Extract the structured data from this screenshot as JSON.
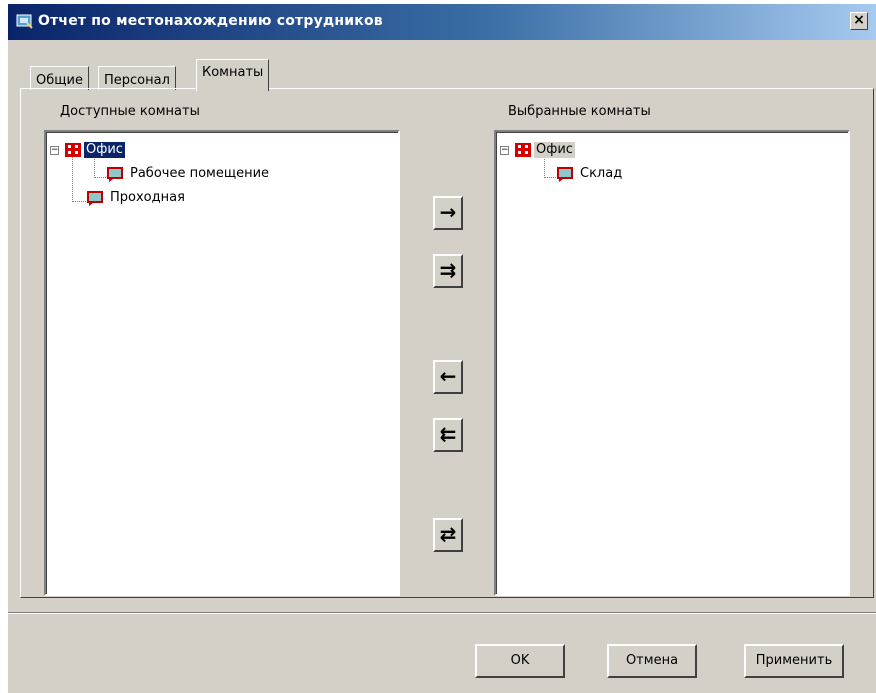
{
  "window": {
    "title": "Отчет по местонахождению сотрудников",
    "close_label": "×"
  },
  "tabs": [
    {
      "label": "Общие",
      "active": false
    },
    {
      "label": "Персонал",
      "active": false
    },
    {
      "label": "Комнаты",
      "active": true
    }
  ],
  "available": {
    "label": "Доступные комнаты",
    "items": [
      {
        "label": "Офис",
        "expanded": true,
        "selected": true
      },
      {
        "label": "Рабочее помещение"
      },
      {
        "label": "Проходная"
      }
    ]
  },
  "selected": {
    "label": "Выбранные комнаты",
    "items": [
      {
        "label": "Офис",
        "expanded": true
      },
      {
        "label": "Склад"
      }
    ]
  },
  "transfer_buttons": {
    "add": "→",
    "add_all": "⇉",
    "remove": "←",
    "remove_all": "⇇",
    "swap": "⇄"
  },
  "footer": {
    "ok": "OK",
    "cancel": "Отмена",
    "apply": "Применить"
  },
  "icons": {
    "window": "report-icon",
    "building": "building-icon",
    "room": "room-icon"
  },
  "colors": {
    "title_start": "#0a246a",
    "title_end": "#a6caf0",
    "face": "#d4d0c8",
    "selection": "#0a246a"
  }
}
